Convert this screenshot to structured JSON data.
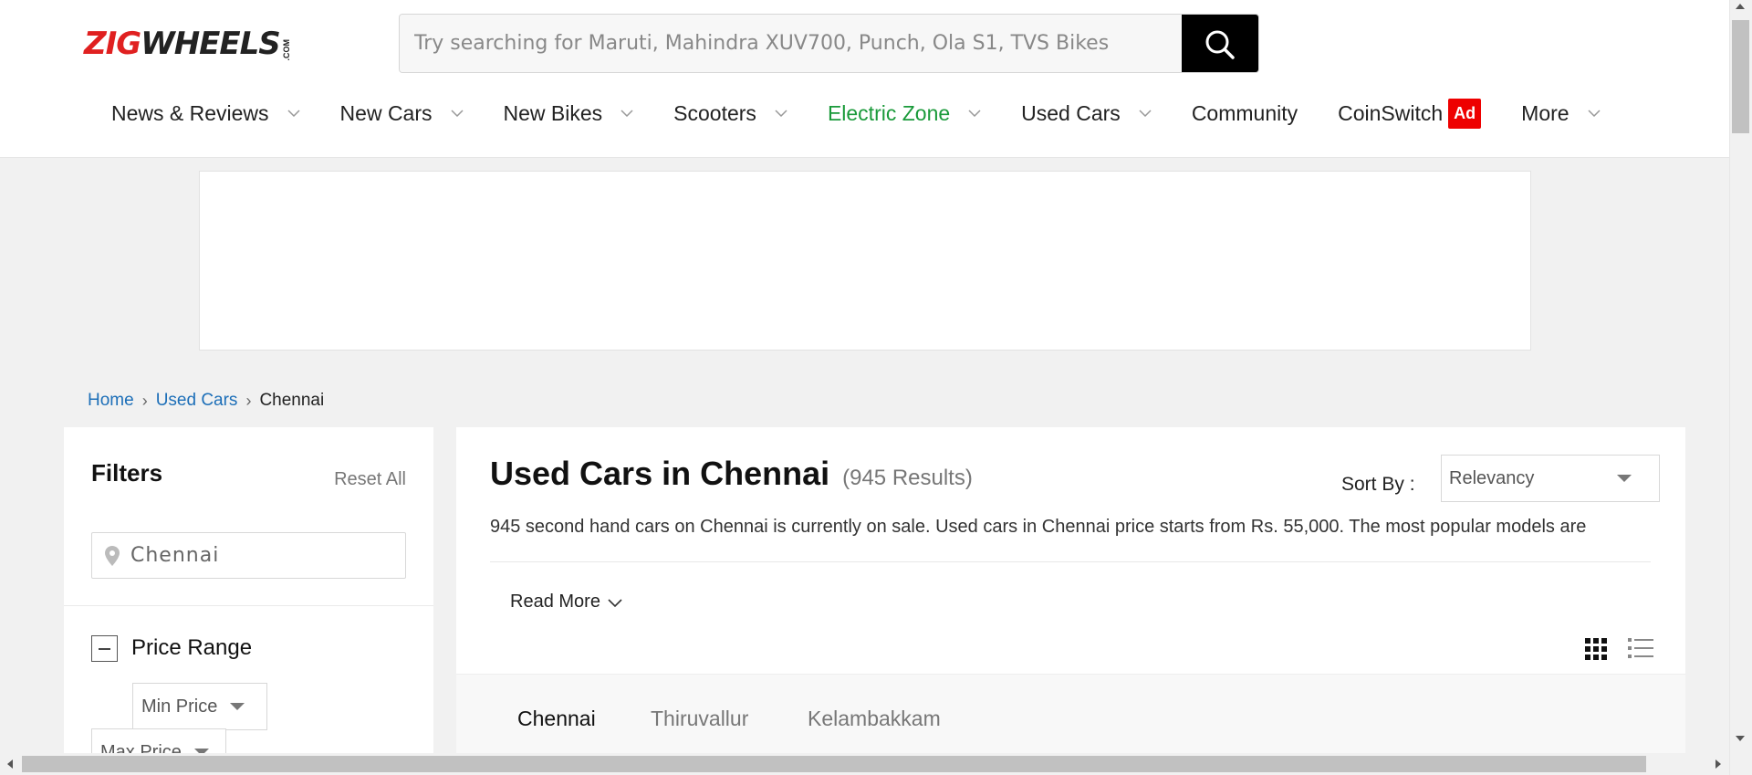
{
  "header": {
    "logo": {
      "zig": "ZIG",
      "wheels": "WHEELS",
      "com": ".COM"
    },
    "search": {
      "placeholder": "Try searching for Maruti, Mahindra XUV700, Punch, Ola S1, TVS Bikes",
      "icon": "search-icon"
    },
    "nav": [
      {
        "label": "News & Reviews",
        "has_dropdown": true
      },
      {
        "label": "New Cars",
        "has_dropdown": true
      },
      {
        "label": "New Bikes",
        "has_dropdown": true
      },
      {
        "label": "Scooters",
        "has_dropdown": true
      },
      {
        "label": "Electric Zone",
        "has_dropdown": true,
        "color": "#1a9a3a"
      },
      {
        "label": "Used Cars",
        "has_dropdown": true
      },
      {
        "label": "Community",
        "has_dropdown": false
      },
      {
        "label": "CoinSwitch",
        "has_dropdown": false,
        "badge": "Ad"
      },
      {
        "label": "More",
        "has_dropdown": true
      }
    ]
  },
  "breadcrumb": {
    "home": "Home",
    "used_cars": "Used Cars",
    "current": "Chennai"
  },
  "filters": {
    "title": "Filters",
    "reset_label": "Reset All",
    "city_value": "Chennai",
    "price_range_label": "Price Range",
    "min_price": "Min Price",
    "max_price": "Max Price"
  },
  "main": {
    "title": "Used Cars in Chennai",
    "count": "(945 Results)",
    "sort_label": "Sort By :",
    "sort_value": "Relevancy",
    "description": "945 second hand cars on Chennai is currently on sale. Used cars in Chennai price starts from Rs. 55,000. The most popular models are",
    "read_more": "Read More",
    "tabs": [
      "Chennai",
      "Thiruvallur",
      "Kelambakkam"
    ],
    "active_tab": "Chennai"
  },
  "colors": {
    "brand_red": "#e02020",
    "link_blue": "#1d6fb8",
    "electric_green": "#1a9a3a",
    "tab_active_underline": "#e0201c"
  }
}
